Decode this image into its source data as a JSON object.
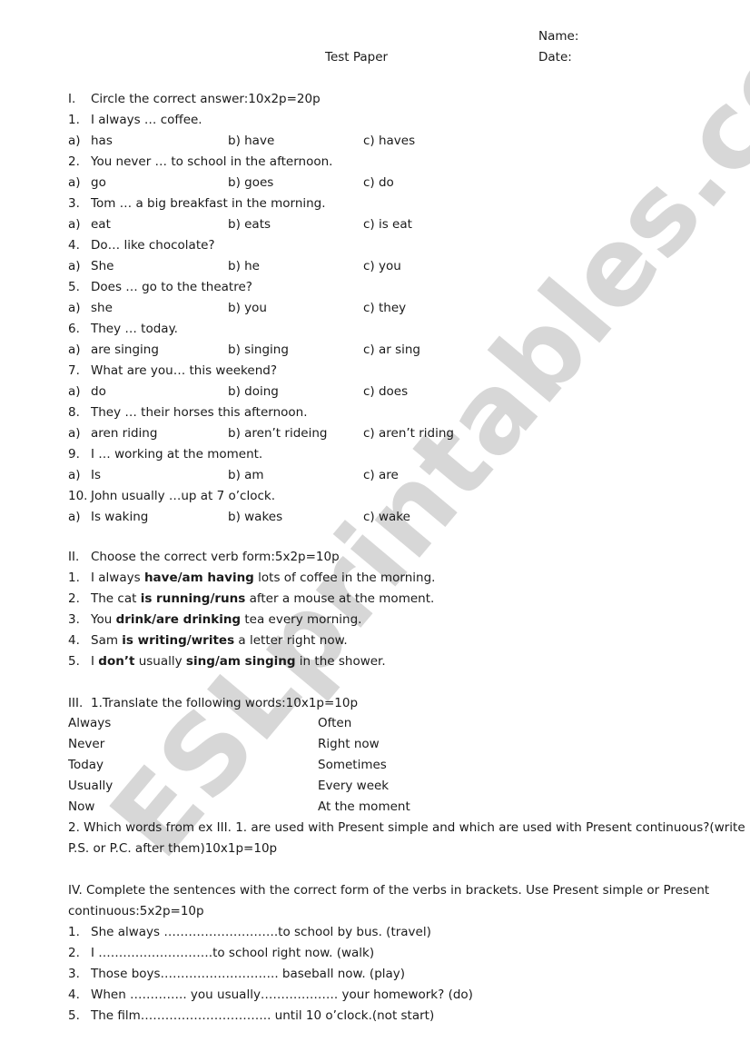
{
  "header": {
    "name_label": "Name:",
    "title": "Test Paper",
    "date_label": "Date:"
  },
  "section1": {
    "num": "I.",
    "title": "Circle the correct answer:10x2p=20p",
    "questions": [
      {
        "num": "1.",
        "text": "I always … coffee.",
        "a": "has",
        "b": "b) have",
        "c": "c) haves"
      },
      {
        "num": "2.",
        "text": "You never … to school in the afternoon.",
        "a": "go",
        "b": "b) goes",
        "c": "c) do"
      },
      {
        "num": "3.",
        "text": "Tom … a big breakfast in the morning.",
        "a": "eat",
        "b": "b) eats",
        "c": "c) is eat"
      },
      {
        "num": "4.",
        "text": "Do… like chocolate?",
        "a": "She",
        "b": "b) he",
        "c": "c) you"
      },
      {
        "num": "5.",
        "text": "Does … go to the theatre?",
        "a": "she",
        "b": "b) you",
        "c": "c) they"
      },
      {
        "num": "6.",
        "text": "They … today.",
        "a": "are singing",
        "b": "b) singing",
        "c": "c) ar sing"
      },
      {
        "num": "7.",
        "text": "What are you… this weekend?",
        "a": "do",
        "b": "b) doing",
        "c": "c) does"
      },
      {
        "num": "8.",
        "text": "They … their horses this afternoon.",
        "a": "aren riding",
        "b": "b) aren’t rideing",
        "c": "c) aren’t riding"
      },
      {
        "num": "9.",
        "text": "I … working at the moment.",
        "a": "Is",
        "b": "b) am",
        "c": "c) are"
      },
      {
        "num": "10.",
        "text": "John usually …up at 7 o’clock.",
        "a": "Is waking",
        "b": "b) wakes",
        "c": "c) wake"
      }
    ],
    "option_a_prefix": "a)"
  },
  "section2": {
    "num": "II.",
    "title": "Choose the correct verb form:5x2p=10p",
    "items": [
      {
        "num": "1.",
        "pre": "I always ",
        "bold": "have/am having",
        "post": " lots of coffee in the morning."
      },
      {
        "num": "2.",
        "pre": "The cat ",
        "bold": "is running/runs",
        "post": " after a mouse at the moment."
      },
      {
        "num": "3.",
        "pre": "You ",
        "bold": "drink/are drinking",
        "post": " tea every morning."
      },
      {
        "num": "4.",
        "pre": "Sam ",
        "bold": "is writing/writes",
        "post": " a letter right now."
      },
      {
        "num": "5.",
        "pre": "I ",
        "bold": "don’t",
        "mid": " usually ",
        "bold2": "sing/am singing",
        "post": " in the shower."
      }
    ]
  },
  "section3": {
    "num": "III.",
    "title": "1.Translate the following words:10x1p=10p",
    "left_words": [
      "Always",
      "Never",
      "Today",
      "Usually",
      "Now"
    ],
    "right_words": [
      "Often",
      "Right now",
      "Sometimes",
      "Every week",
      "At the moment"
    ],
    "part2_line1": "2. Which words from ex III. 1. are used with Present simple and which are used with Present continuous?(write",
    "part2_line2": "P.S. or P.C. after them)10x1p=10p"
  },
  "section4": {
    "title_line1": "IV. Complete the sentences with the correct form of the verbs in brackets. Use Present simple or Present",
    "title_line2": "continuous:5x2p=10p",
    "items": [
      {
        "num": "1.",
        "text": "She always ……………………….to school by bus. (travel)"
      },
      {
        "num": "2.",
        "text": "I ……………………….to school right now. (walk)"
      },
      {
        "num": "3.",
        "text": "Those boys……………………….. baseball now. (play)"
      },
      {
        "num": "4.",
        "text": "When ………….. you usually………………. your homework? (do)"
      },
      {
        "num": "5.",
        "text": "The film………………………….. until 10 o’clock.(not start)"
      }
    ]
  },
  "watermark": "ESLprintables.com"
}
